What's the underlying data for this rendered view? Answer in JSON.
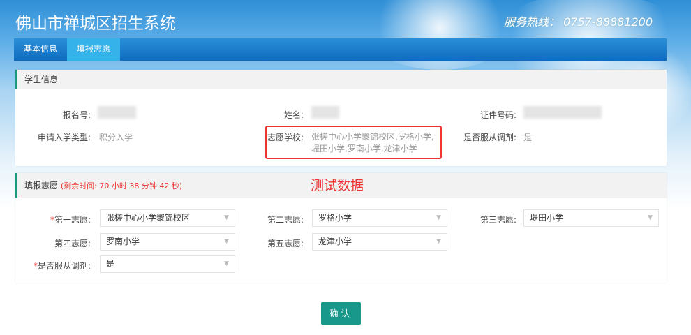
{
  "header": {
    "title": "佛山市禅城区招生系统",
    "hotline": "服务热线： 0757-88881200"
  },
  "nav": {
    "tabs": [
      {
        "label": "基本信息"
      },
      {
        "label": "填报志愿"
      }
    ]
  },
  "student": {
    "section_title": "学生信息",
    "reg_no_label": "报名号:",
    "name_label": "姓名:",
    "id_label": "证件号码:",
    "type_label": "申请入学类型:",
    "type_value": "积分入学",
    "schools_label": "志愿学校:",
    "schools_value": "张槎中心小学聚锦校区,罗格小学,堤田小学,罗南小学,龙津小学",
    "adjust_label": "是否服从调剂:",
    "adjust_value": "是"
  },
  "form": {
    "section_title": "填报志愿",
    "remaining": "(剩余时间: 70 小时 38 分钟 42 秒)",
    "annotation": "测试数据",
    "fields": [
      {
        "label": "第一志愿:",
        "value": "张槎中心小学聚锦校区",
        "required": true
      },
      {
        "label": "第二志愿:",
        "value": "罗格小学"
      },
      {
        "label": "第三志愿:",
        "value": "堤田小学"
      },
      {
        "label": "第四志愿:",
        "value": "罗南小学"
      },
      {
        "label": "第五志愿:",
        "value": "龙津小学"
      },
      {
        "label": "是否服从调剂:",
        "value": "是",
        "required": true
      }
    ],
    "required_mark": "*",
    "arrow": "▼"
  },
  "confirm_label": "确认"
}
